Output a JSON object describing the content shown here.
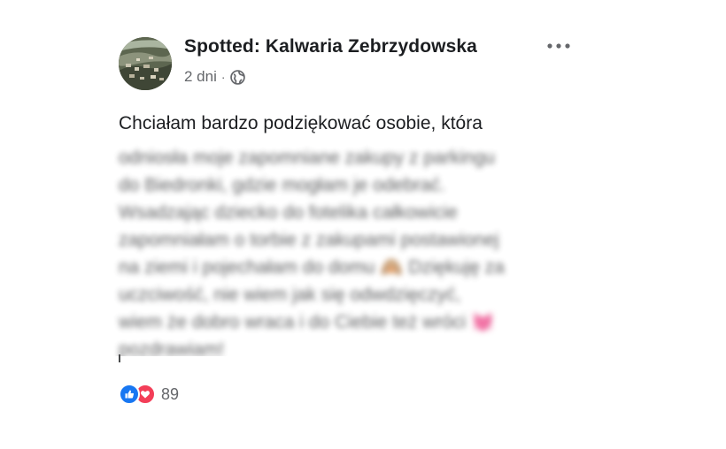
{
  "post": {
    "page_name": "Spotted: Kalwaria Zebrzydowska",
    "time_ago": "2 dni",
    "separator": "·",
    "privacy_icon": "globe-icon",
    "more_icon": "more-options-icon",
    "text_visible": "Chciałam bardzo podziękować  osobie, która",
    "text_blurred": [
      "odniosła moje zapomniane zakupy z parkingu",
      "do Biedronki, gdzie mogłam je odebrać.",
      "Wsadzając dziecko do fotelika całkowicie",
      "zapomniałam o torbie z zakupami postawionej",
      "na ziemi i pojechałam do domu 🙈 Dziękuję za",
      "uczciwość, nie wiem jak się odwdzięczyć,",
      "wiem że dobro wraca i do Ciebie też wróci 💓",
      "pozdrawiam!"
    ]
  },
  "reactions": {
    "icons": [
      "like-icon",
      "love-icon"
    ],
    "count": "89",
    "like_color": "#1877f2",
    "love_color": "#f33e58"
  },
  "colors": {
    "text": "#1c1e21",
    "secondary": "#65676b",
    "background": "#ffffff"
  }
}
